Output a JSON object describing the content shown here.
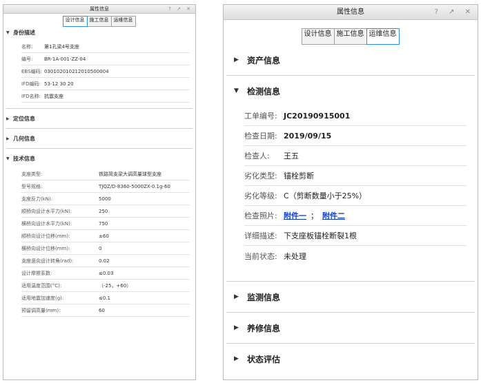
{
  "left": {
    "title": "属性信息",
    "controls": "? ↗ ✕",
    "tabs": [
      "设计信息",
      "施工信息",
      "运维信息"
    ],
    "identity": {
      "heading": "身份描述",
      "rows": [
        {
          "label": "名称:",
          "value": "第1孔梁4号支座"
        },
        {
          "label": "编号:",
          "value": "BR-1A-001-ZZ-04"
        },
        {
          "label": "EBS编码:",
          "value": "030102010212010500004"
        },
        {
          "label": "IFD编码:",
          "value": "53-12 30 20"
        },
        {
          "label": "IFD名称:",
          "value": "抗震支座"
        }
      ]
    },
    "positioning": {
      "heading": "定位信息"
    },
    "geometry": {
      "heading": "几何信息"
    },
    "technical": {
      "heading": "技术信息",
      "rows": [
        {
          "label": "支座类型:",
          "value": "铁路简支梁大调高量球型支座"
        },
        {
          "label": "型号规格:",
          "value": "TJQZ/D-8360-5000ZX-0.1g-60"
        },
        {
          "label": "支座反力(kN):",
          "value": "5000"
        },
        {
          "label": "顺桥向设计水平力(kN):",
          "value": "250"
        },
        {
          "label": "横桥向设计水平力(kN):",
          "value": "750"
        },
        {
          "label": "顺桥向设计位移(mm):",
          "value": "±60"
        },
        {
          "label": "横桥向设计位移(mm):",
          "value": "0"
        },
        {
          "label": "支座竖向设计转角(rad):",
          "value": "0.02"
        },
        {
          "label": "设计摩擦系数:",
          "value": "≤0.03"
        },
        {
          "label": "适用温度范围(°C):",
          "value": "（-25，+60）"
        },
        {
          "label": "适用地震加速度(g):",
          "value": "≤0.1"
        },
        {
          "label": "预留调高量(mm):",
          "value": "60"
        }
      ]
    }
  },
  "right": {
    "title": "属性信息",
    "controls": "? ↗ ✕",
    "tabs": [
      "设计信息",
      "施工信息",
      "运维信息"
    ],
    "asset": {
      "heading": "资产信息"
    },
    "inspection": {
      "heading": "检测信息",
      "rows": [
        {
          "label": "工单编号:",
          "value": "JC20190915001"
        },
        {
          "label": "检查日期:",
          "value": "2019/09/15"
        },
        {
          "label": "检查人:",
          "value": "王五"
        },
        {
          "label": "劣化类型:",
          "value": "锚栓剪断"
        },
        {
          "label": "劣化等级:",
          "value": "C（剪断数量小于25%）"
        },
        {
          "label": "检查照片:",
          "link1": "附件一",
          "separator": "；",
          "link2": "附件二"
        },
        {
          "label": "详细描述:",
          "value": "下支座板锚栓断裂1根"
        },
        {
          "label": "当前状态:",
          "value": "未处理"
        }
      ]
    },
    "monitoring": {
      "heading": "监测信息"
    },
    "maintenance": {
      "heading": "养修信息"
    },
    "assessment": {
      "heading": "状态评估"
    }
  }
}
